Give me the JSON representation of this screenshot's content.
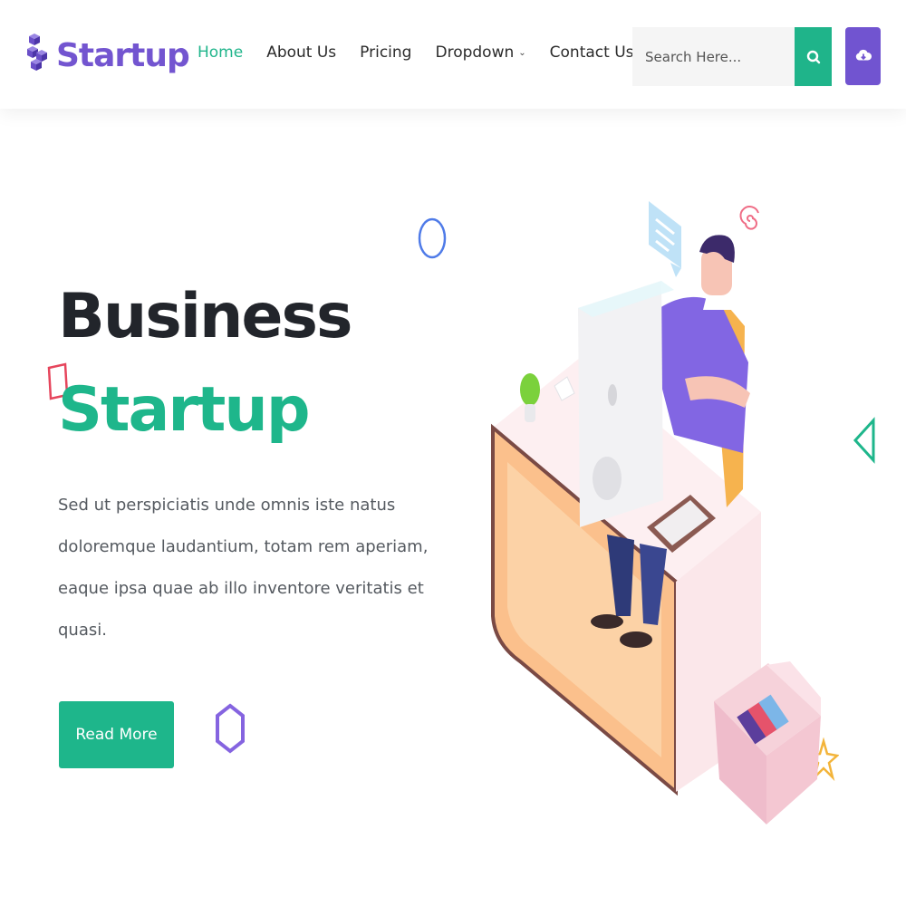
{
  "brand": {
    "name": "Startup"
  },
  "nav": {
    "items": [
      {
        "label": "Home"
      },
      {
        "label": "About Us"
      },
      {
        "label": "Pricing"
      },
      {
        "label": "Dropdown"
      },
      {
        "label": "Contact Us"
      }
    ]
  },
  "search": {
    "placeholder": "Search Here..."
  },
  "hero": {
    "title_line1": "Business",
    "title_line2": "Startup",
    "description": "Sed ut perspiciatis unde omnis iste natus doloremque laudantium, totam rem aperiam, eaque ipsa quae ab illo inventore veritatis et quasi.",
    "cta_label": "Read More"
  },
  "colors": {
    "primary_green": "#1eb68b",
    "brand_purple": "#7355d0",
    "heading_dark": "#22252b"
  },
  "icons": {
    "search": "search-icon",
    "download": "download-icon",
    "dropdown": "chevron-down-icon"
  }
}
